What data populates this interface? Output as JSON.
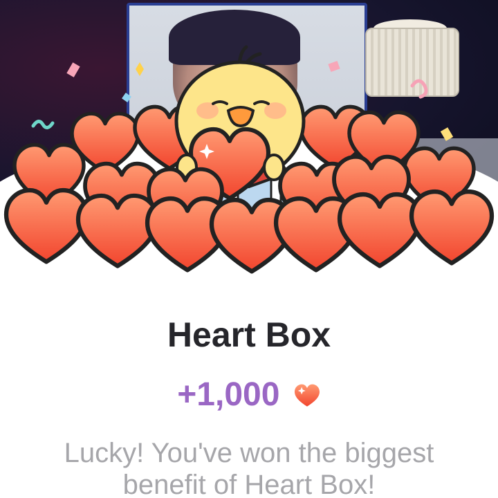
{
  "popup": {
    "title": "Heart Box",
    "reward_amount": "+1,000",
    "message_line1": "Lucky! You've won the biggest",
    "message_line2": "benefit of Heart Box!",
    "reward_icon": "heart-icon"
  },
  "colors": {
    "title": "#26262b",
    "reward": "#9a67c4",
    "message": "#a6a6aa",
    "heart_top": "#ff8a66",
    "heart_bottom": "#f2452e",
    "chick_yellow": "#fde58a"
  }
}
